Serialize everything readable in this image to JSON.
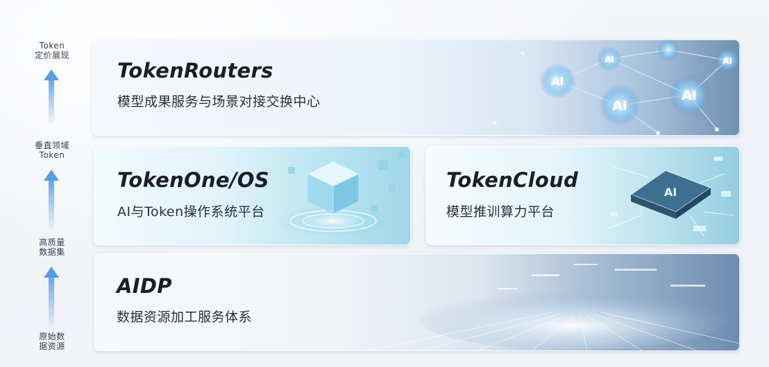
{
  "side": {
    "labels": [
      "Token\n定价展现",
      "垂直领域\nToken",
      "高质量\n数据集",
      "原始数\n据资源"
    ]
  },
  "cards": {
    "routers": {
      "title": "TokenRouters",
      "subtitle": "模型成果服务与场景对接交换中心",
      "art_labels": [
        "AI",
        "AI",
        "AI",
        "AI",
        "AI"
      ]
    },
    "tokenone": {
      "title": "TokenOne/OS",
      "subtitle": "AI与Token操作系统平台"
    },
    "tokencloud": {
      "title": "TokenCloud",
      "subtitle": "模型推训算力平台",
      "art_labels": [
        "AI"
      ]
    },
    "aidp": {
      "title": "AIDP",
      "subtitle": "数据资源加工服务体系"
    }
  },
  "colors": {
    "arrow": "#5a9be6",
    "title_text": "#1b1e26",
    "subtitle_text": "#2a2f3a",
    "side_text": "#384252"
  }
}
